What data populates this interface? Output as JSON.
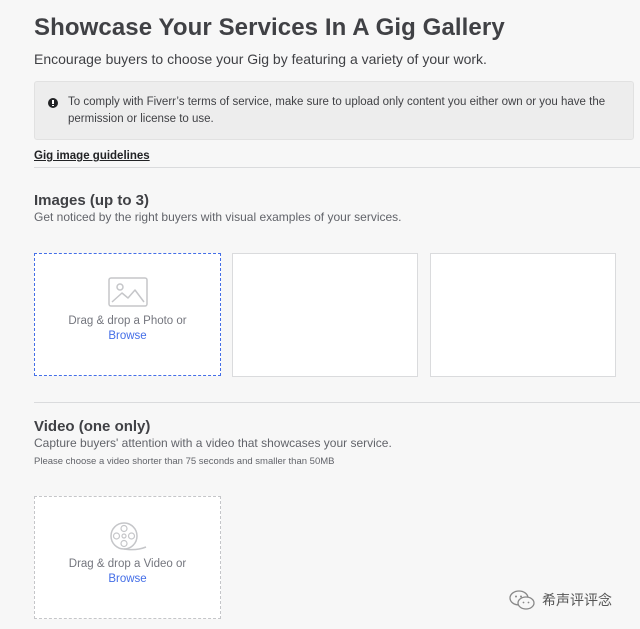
{
  "page": {
    "title": "Showcase Your Services In A Gig Gallery",
    "subtitle": "Encourage buyers to choose your Gig by featuring a variety of your work."
  },
  "notice": {
    "icon": "info-icon",
    "text": "To comply with Fiverr’s terms of service, make sure to upload only content you either own or you have the permission or license to use."
  },
  "guidelines_link": "Gig image guidelines",
  "images_section": {
    "title": "Images (up to 3)",
    "description": "Get noticed by the right buyers with visual examples of your services.",
    "slots": [
      {
        "state": "active",
        "icon": "image-icon",
        "label": "Drag & drop a Photo or",
        "browse": "Browse"
      },
      {
        "state": "empty"
      },
      {
        "state": "empty"
      }
    ]
  },
  "video_section": {
    "title": "Video (one only)",
    "description": "Capture buyers' attention with a video that showcases your service.",
    "note": "Please choose a video shorter than 75 seconds and smaller than 50MB",
    "slot": {
      "icon": "film-reel-icon",
      "label": "Drag & drop a Video or",
      "browse": "Browse"
    }
  },
  "watermark": {
    "text": "希声评评念",
    "icon": "wechat-logo-icon"
  },
  "colors": {
    "accent": "#446ee7",
    "text": "#404145",
    "muted": "#62646a",
    "background": "#f7f7f7"
  }
}
